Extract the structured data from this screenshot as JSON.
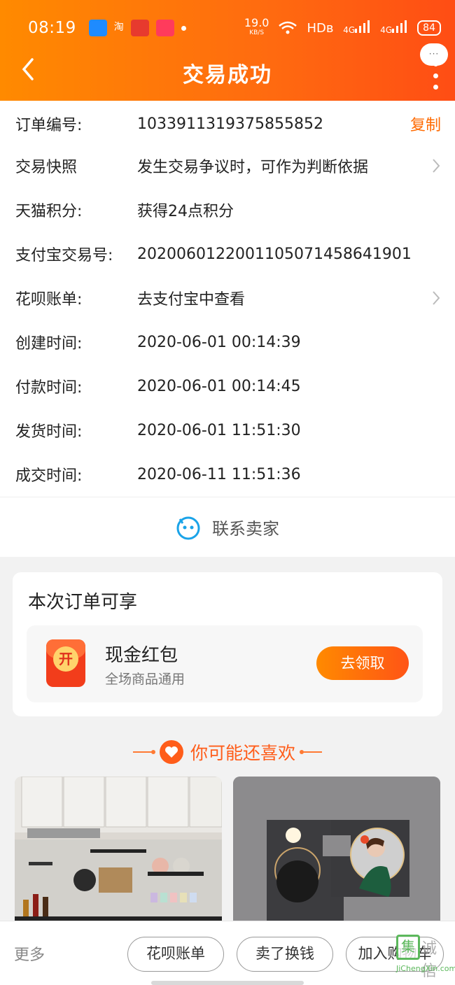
{
  "status_bar": {
    "time": "08:19",
    "app_icons": [
      "alipay-icon",
      "taobao-icon",
      "app-icon-3",
      "app-icon-4"
    ],
    "net_speed": "19.0",
    "net_unit": "KB/S",
    "hd_label": "HDʙ",
    "signal1": "4G",
    "signal2": "4G",
    "battery": "84"
  },
  "header": {
    "title": "交易成功",
    "bubble": "···"
  },
  "order_info": {
    "rows": [
      {
        "label": "订单编号:",
        "value": "1033911319375855852",
        "action": "复制"
      },
      {
        "label": "交易快照",
        "value": "发生交易争议时，可作为判断依据"
      },
      {
        "label": "天猫积分:",
        "value": "获得24点积分"
      },
      {
        "label": "支付宝交易号:",
        "value": "2020060122001105071458641901"
      },
      {
        "label": "花呗账单:",
        "value": "去支付宝中查看"
      },
      {
        "label": "创建时间:",
        "value": "2020-06-01 00:14:39"
      },
      {
        "label": "付款时间:",
        "value": "2020-06-01 00:14:45"
      },
      {
        "label": "发货时间:",
        "value": "2020-06-01 11:51:30"
      },
      {
        "label": "成交时间:",
        "value": "2020-06-11 11:51:36"
      }
    ]
  },
  "contact": {
    "label": "联系卖家"
  },
  "benefit": {
    "title": "本次订单可享",
    "coin_text": "开",
    "coupon_title": "现金红包",
    "coupon_sub": "全场商品通用",
    "claim_label": "去领取"
  },
  "recommend": {
    "title": "你可能还喜欢"
  },
  "bottom_bar": {
    "more": "更多",
    "buttons": [
      "花呗账单",
      "卖了换钱",
      "加入购物车"
    ]
  },
  "watermark": {
    "box": "集",
    "text": "诚信",
    "url": "JiChengXin.com"
  },
  "colors": {
    "accent": "#ff6a00",
    "header_start": "#ff8a00",
    "header_end": "#ff4d14"
  }
}
